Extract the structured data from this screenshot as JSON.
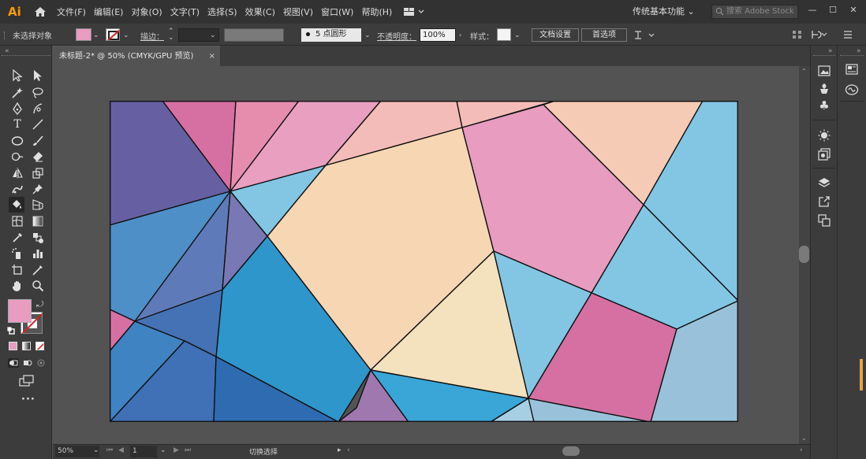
{
  "app": {
    "logo": "Ai",
    "menus": [
      "文件(F)",
      "编辑(E)",
      "对象(O)",
      "文字(T)",
      "选择(S)",
      "效果(C)",
      "视图(V)",
      "窗口(W)",
      "帮助(H)"
    ],
    "workspace": "传统基本功能",
    "search_placeholder": "搜索 Adobe Stock",
    "window_controls": [
      "—",
      "☐",
      "✕"
    ]
  },
  "controlbar": {
    "selection_status": "未选择对象",
    "stroke_label": "描边：",
    "brush_label": "5 点圆形",
    "opacity_label": "不透明度：",
    "opacity_value": "100%",
    "style_label": "样式：",
    "doc_setup_button": "文档设置",
    "preferences_button": "首选项",
    "fill_color": "#e89cbf"
  },
  "document": {
    "tab_title": "未标题-2* @ 50% (CMYK/GPU 预览)",
    "close_glyph": "×"
  },
  "statusbar": {
    "zoom": "50%",
    "page": "1",
    "status": "切换选择"
  },
  "artwork_colors": {
    "pink": "#e89cbf",
    "magenta": "#d670a3",
    "purple": "#6660a3",
    "blue": "#4f8bc6",
    "light_blue": "#7fc4e4",
    "peach": "#f7d6b4",
    "light_peach": "#f5e0bd",
    "salmon": "#f4bcb8"
  }
}
